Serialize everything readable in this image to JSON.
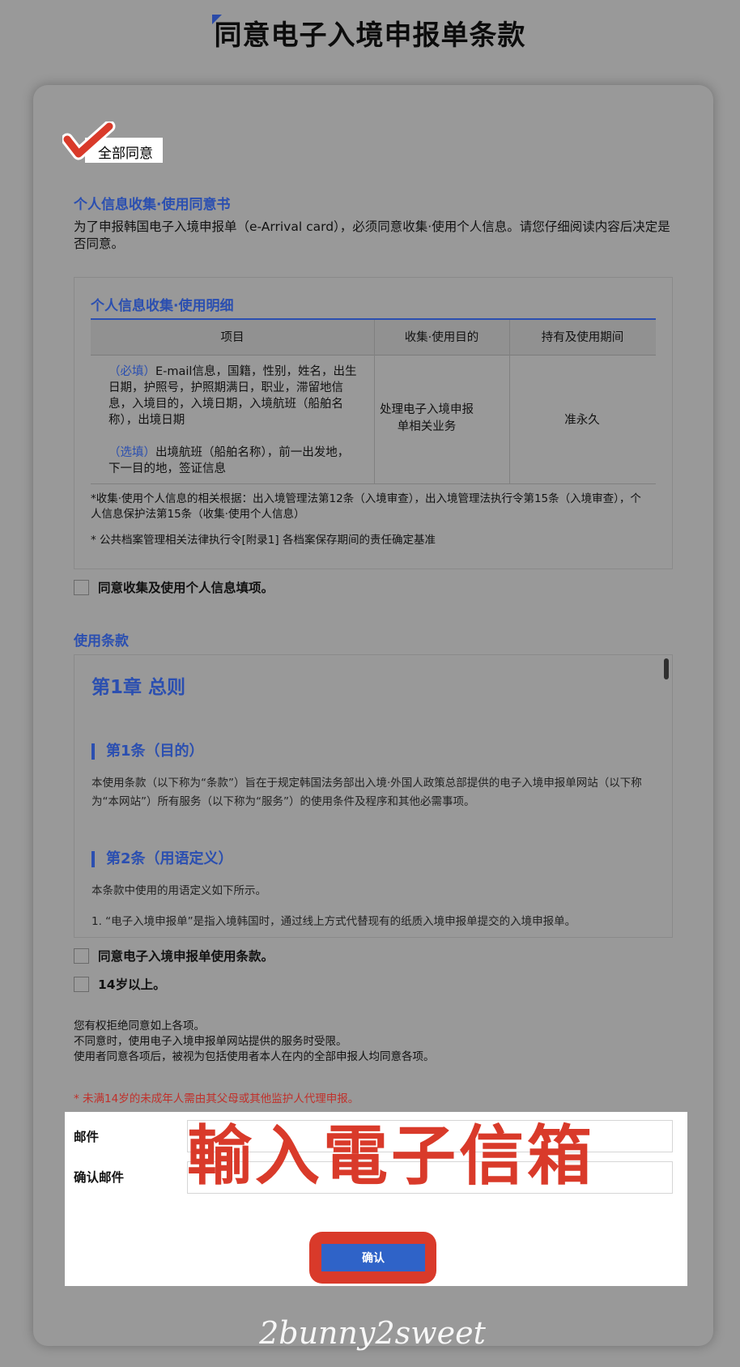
{
  "page": {
    "title": "同意电子入境申报单条款"
  },
  "agree_all": {
    "label": "全部同意"
  },
  "privacy": {
    "section_title": "个人信息收集·使用同意书",
    "intro": "为了申报韩国电子入境申报单（e-Arrival card），必须同意收集·使用个人信息。请您仔细阅读内容后决定是否同意。",
    "details_title": "个人信息收集·使用明细",
    "columns": [
      "项目",
      "收集·使用目的",
      "持有及使用期间"
    ],
    "required_tag": "（必填）",
    "required_items": "E-mail信息，国籍，性别，姓名，出生日期，护照号，护照期满日，职业，滞留地信息，入境目的，入境日期，入境航班（船舶名称），出境日期",
    "optional_tag": "（选填）",
    "optional_items": "出境航班（船舶名称），前一出发地，下一目的地，签证信息",
    "purpose": "处理电子入境申报单相关业务",
    "period": "准永久",
    "note1": "*收集·使用个人信息的相关根据：出入境管理法第12条（入境审查），出入境管理法执行令第15条（入境审查），个人信息保护法第15条（收集·使用个人信息）",
    "note2": "* 公共档案管理相关法律执行令[附录1] 各档案保存期间的责任确定基准",
    "checkbox_label": "同意收集及使用个人信息填项。"
  },
  "terms": {
    "section_title": "使用条款",
    "chapter": "第1章 总则",
    "article1_title": "第1条（目的）",
    "article1_text": "本使用条款（以下称为“条款”）旨在于规定韩国法务部出入境·外国人政策总部提供的电子入境申报单网站（以下称为“本网站”）所有服务（以下称为“服务”）的使用条件及程序和其他必需事项。",
    "article2_title": "第2条（用语定义）",
    "article2_text": "本条款中使用的用语定义如下所示。",
    "article2_item1": "1. “电子入境申报单”是指入境韩国时，通过线上方式代替现有的纸质入境申报单提交的入境申报单。",
    "checkbox_terms": "同意电子入境申报单使用条款。",
    "checkbox_age": "14岁以上。"
  },
  "rights": {
    "line1": "您有权拒绝同意如上各项。",
    "line2": "不同意时，使用电子入境申报单网站提供的服务时受限。",
    "line3": "使用者同意各项后，被视为包括使用者本人在内的全部申报人均同意各项。",
    "minor_note": "* 未满14岁的未成年人需由其父母或其他监护人代理申报。"
  },
  "email": {
    "label": "邮件",
    "value": "",
    "confirm_label": "确认邮件",
    "confirm_value": ""
  },
  "overlay": {
    "text": "輸入電子信箱"
  },
  "confirm_button": {
    "label": "确认"
  },
  "watermark": {
    "text": "2bunny2sweet"
  },
  "colors": {
    "accent_blue": "#2b4fb0",
    "highlight_red": "#d93a2a",
    "button_blue": "#2f63c8",
    "page_gray": "#999999"
  }
}
